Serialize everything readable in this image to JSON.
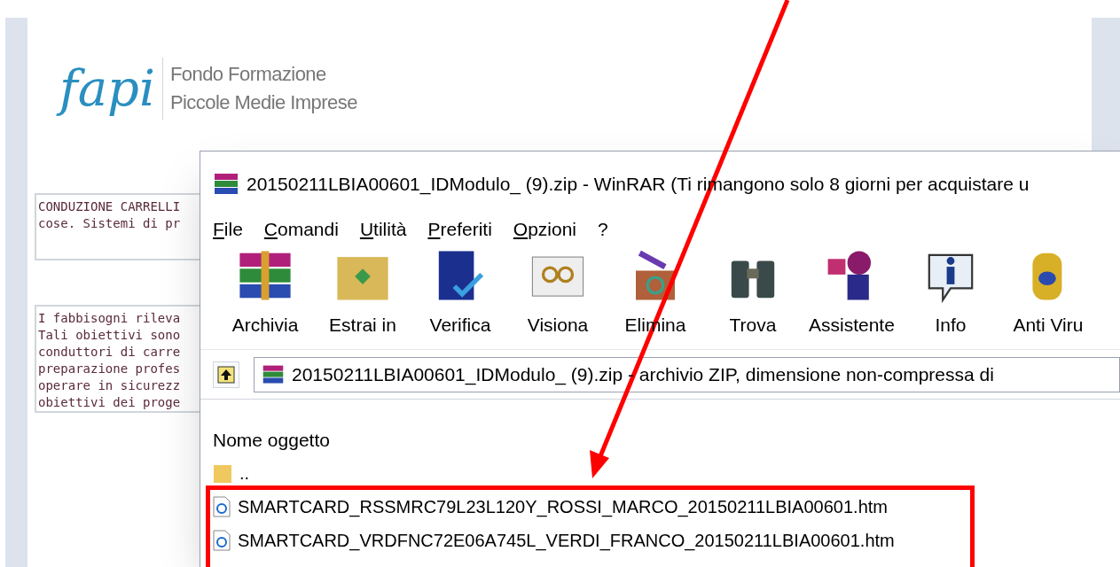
{
  "page": {
    "logo": {
      "mark": "fapi",
      "line_1": "Fondo Formazione",
      "line_2": "Piccole Medie Imprese"
    },
    "text_boxes": [
      {
        "lines": [
          "CONDUZIONE CARRELLI",
          "cose. Sistemi di pr"
        ]
      },
      {
        "lines": [
          "I fabbisogni rileva",
          "Tali obiettivi sono",
          "conduttori di carre",
          "preparazione profes",
          "operare in sicurezz",
          "obiettivi dei proge"
        ]
      }
    ]
  },
  "window": {
    "title": "20150211LBIA00601_IDModulo_ (9).zip - WinRAR (Ti rimangono solo 8 giorni per acquistare u",
    "menu": [
      "File",
      "Comandi",
      "Utilità",
      "Preferiti",
      "Opzioni",
      "?"
    ],
    "toolbar": [
      {
        "label": "Archivia",
        "kind": "archive"
      },
      {
        "label": "Estrai in",
        "kind": "extract"
      },
      {
        "label": "Verifica",
        "kind": "verify"
      },
      {
        "label": "Visiona",
        "kind": "view"
      },
      {
        "label": "Elimina",
        "kind": "delete"
      },
      {
        "label": "Trova",
        "kind": "find"
      },
      {
        "label": "Assistente",
        "kind": "wizard"
      },
      {
        "label": "Info",
        "kind": "info"
      },
      {
        "label": "Anti Viru",
        "kind": "antivirus"
      }
    ],
    "address": "20150211LBIA00601_IDModulo_ (9).zip - archivio ZIP, dimensione non-compressa di",
    "file_list": {
      "columns": [
        "Nome oggetto"
      ],
      "rows": [
        {
          "name": "..",
          "kind": "folder"
        },
        {
          "name": "SMARTCARD_RSSMRC79L23L120Y_ROSSI_MARCO_20150211LBIA00601.htm",
          "kind": "htm"
        },
        {
          "name": "SMARTCARD_VRDFNC72E06A745L_VERDI_FRANCO_20150211LBIA00601.htm",
          "kind": "htm"
        }
      ]
    }
  }
}
